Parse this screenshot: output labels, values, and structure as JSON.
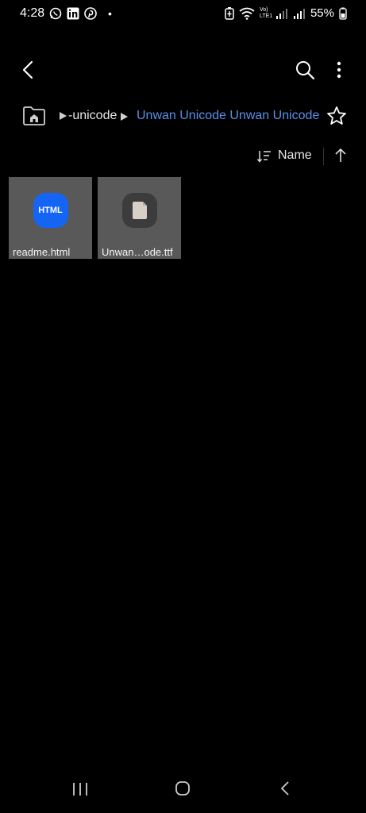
{
  "status": {
    "time": "4:28",
    "dot": "•",
    "battery": "55%",
    "network": "Vo) LTE1",
    "app_icons": [
      "whatsapp-icon",
      "linkedin-icon",
      "pinterest-icon"
    ]
  },
  "toolbar": {
    "back_icon": "chevron-left-icon",
    "search_icon": "search-icon",
    "more_icon": "more-vert-icon"
  },
  "breadcrumb": {
    "first": "-unicode",
    "current": "Unwan Unicode Unwan Unicode"
  },
  "sort": {
    "label": "Name",
    "direction": "ascending"
  },
  "files": [
    {
      "name": "readme.html",
      "icon_text": "HTML",
      "type": "html"
    },
    {
      "name": "Unwan…ode.ttf",
      "type": "font"
    }
  ],
  "colors": {
    "accent": "#5b8fe8",
    "html_icon": "#1565f5",
    "tile_bg": "#595959"
  }
}
